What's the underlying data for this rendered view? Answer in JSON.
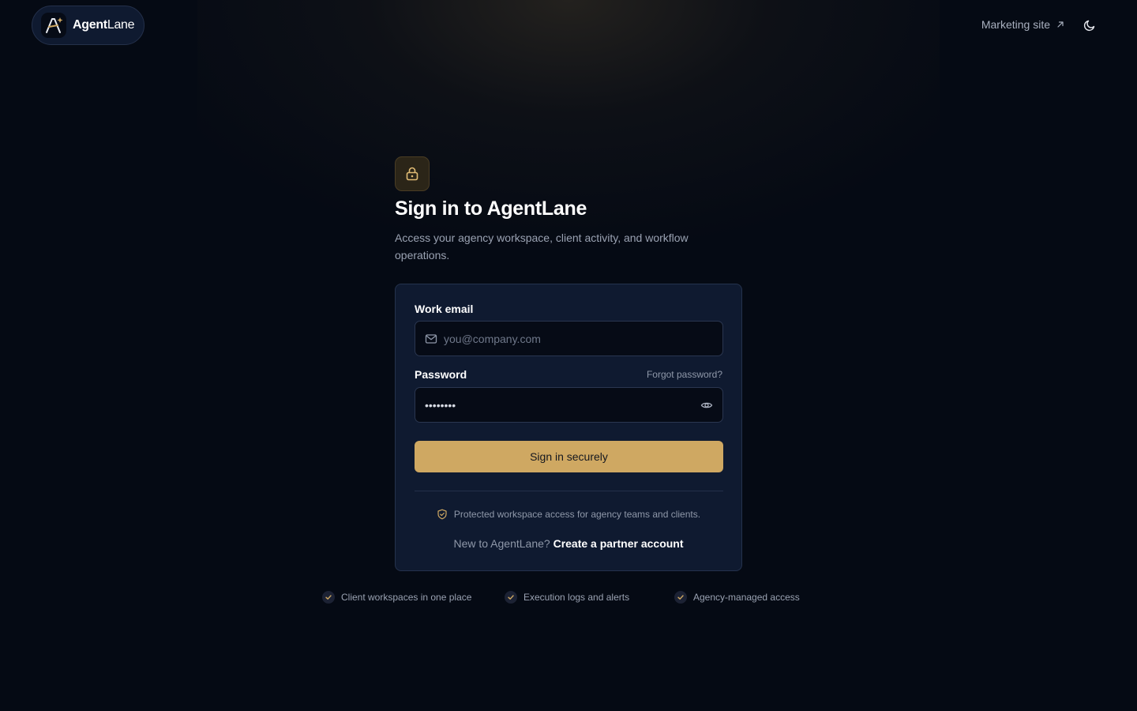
{
  "header": {
    "brand_bold": "Agent",
    "brand_light": "Lane",
    "marketing_link": "Marketing site"
  },
  "hero": {
    "title": "Sign in to AgentLane",
    "subtitle": "Access your agency workspace, client activity, and workflow operations."
  },
  "form": {
    "email_label": "Work email",
    "email_placeholder": "you@company.com",
    "password_label": "Password",
    "forgot_link": "Forgot password?",
    "password_value": "••••••••",
    "submit_label": "Sign in securely",
    "protected_note": "Protected workspace access for agency teams and clients.",
    "new_prompt": "New to AgentLane?",
    "create_link": "Create a partner account"
  },
  "features": [
    "Client workspaces in one place",
    "Execution logs and alerts",
    "Agency-managed access"
  ],
  "colors": {
    "background": "#050a14",
    "card": "#0f1a30",
    "accent": "#cfa862"
  },
  "icons": {
    "logo": "sparkle-a-icon",
    "external": "arrow-up-right-icon",
    "theme": "moon-icon",
    "lock": "lock-icon",
    "email": "mail-icon",
    "visibility": "eye-icon",
    "shield": "shield-check-icon",
    "check": "check-icon"
  }
}
